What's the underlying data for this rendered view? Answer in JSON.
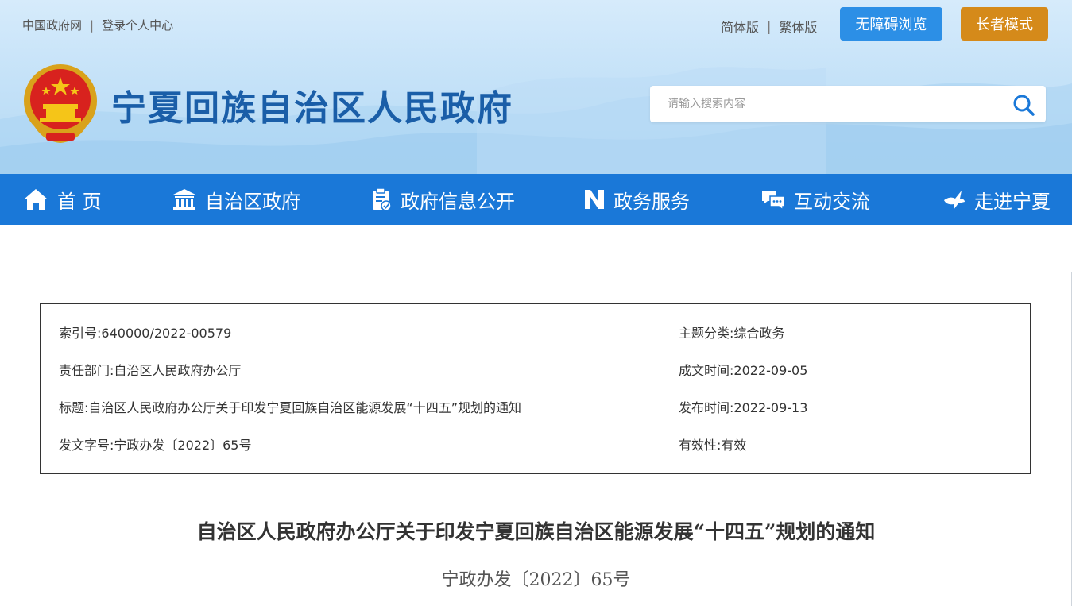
{
  "top_links": {
    "gov_portal": "中国政府网",
    "separator": "|",
    "login": "登录个人中心"
  },
  "lang": {
    "simplified": "简体版",
    "separator": "|",
    "traditional": "繁体版"
  },
  "buttons": {
    "accessible": "无障碍浏览",
    "elder": "长者模式"
  },
  "site": {
    "title": "宁夏回族自治区人民政府"
  },
  "search": {
    "placeholder": "请输入搜索内容"
  },
  "nav": {
    "items": [
      {
        "label": "首 页",
        "icon": "home-icon"
      },
      {
        "label": "自治区政府",
        "icon": "government-building-icon"
      },
      {
        "label": "政府信息公开",
        "icon": "document-check-icon"
      },
      {
        "label": "政务服务",
        "icon": "service-n-icon"
      },
      {
        "label": "互动交流",
        "icon": "chat-bubbles-icon"
      },
      {
        "label": "走进宁夏",
        "icon": "dove-icon"
      }
    ]
  },
  "meta": {
    "index_label": "索引号:",
    "index_value": "640000/2022-00579",
    "topic_label": "主题分类:",
    "topic_value": "综合政务",
    "dept_label": "责任部门:",
    "dept_value": "自治区人民政府办公厅",
    "created_label": "成文时间:",
    "created_value": "2022-09-05",
    "title_label": "标题:",
    "title_value": "自治区人民政府办公厅关于印发宁夏回族自治区能源发展“十四五”规划的通知",
    "published_label": "发布时间:",
    "published_value": "2022-09-13",
    "docno_label": "发文字号:",
    "docno_value": "宁政办发〔2022〕65号",
    "validity_label": "有效性:",
    "validity_value": "有效"
  },
  "document": {
    "title": "自治区人民政府办公厅关于印发宁夏回族自治区能源发展“十四五”规划的通知",
    "number": "宁政办发〔2022〕65号"
  },
  "colors": {
    "nav_blue": "#1a78d8",
    "title_blue": "#1a5ea8",
    "accessible_btn": "#2c8fe6",
    "elder_btn": "#d58a1a"
  }
}
